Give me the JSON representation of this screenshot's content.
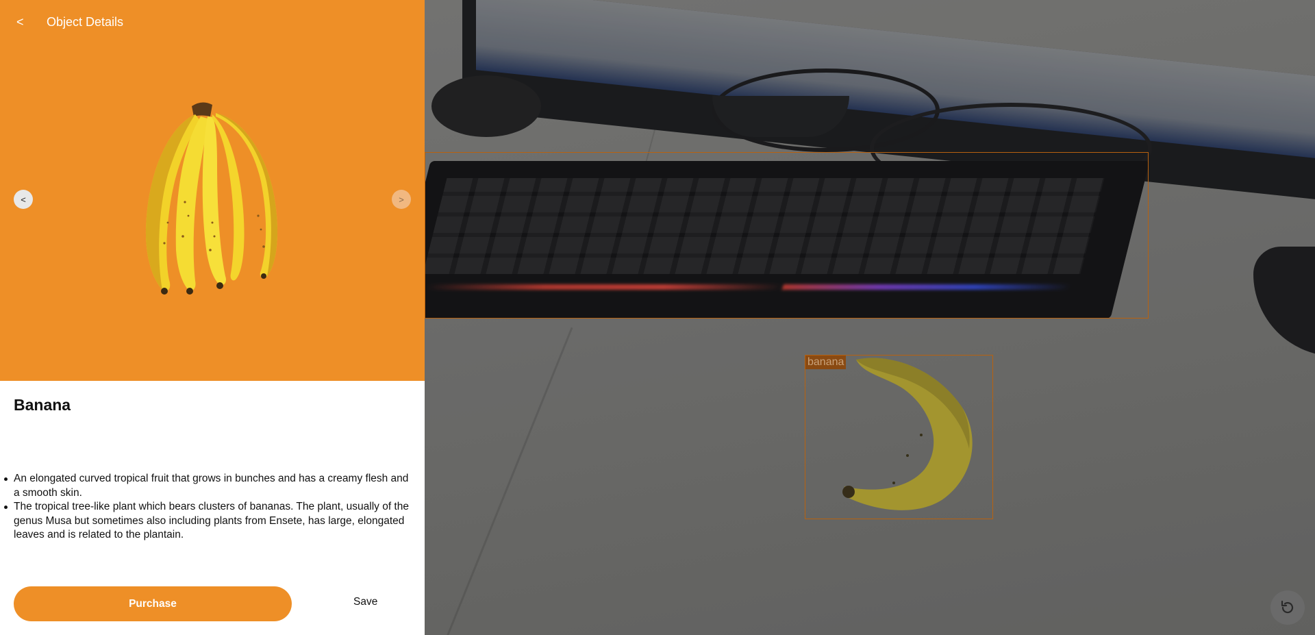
{
  "header": {
    "back_label": "<",
    "title": "Object Details"
  },
  "carousel": {
    "prev_label": "<",
    "next_label": ">"
  },
  "object": {
    "name": "Banana",
    "descriptions": [
      "An elongated curved tropical fruit that grows in bunches and has a creamy flesh and a smooth skin.",
      "The tropical tree-like plant which bears clusters of bananas. The plant, usually of the genus Musa but sometimes also including plants from Ensete, has large, elongated leaves and is related to the plantain."
    ]
  },
  "actions": {
    "purchase_label": "Purchase",
    "save_label": "Save"
  },
  "detections": [
    {
      "label": ""
    },
    {
      "label": "banana"
    }
  ],
  "colors": {
    "accent": "#ee8f27",
    "bbox": "#b8620f",
    "bbox_label_bg": "#8a4a12"
  },
  "icons": {
    "reset": "rotate-ccw-icon"
  }
}
